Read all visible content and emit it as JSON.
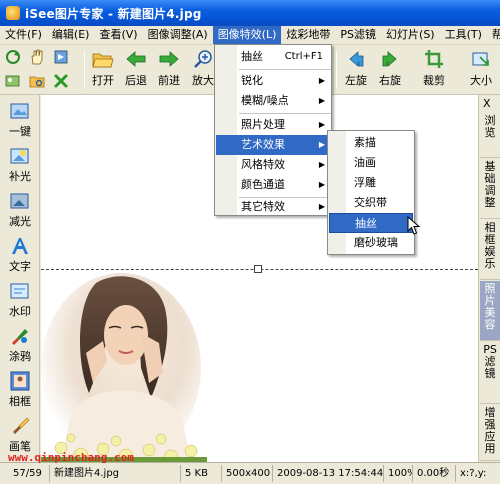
{
  "window": {
    "title": "iSee图片专家 - 新建图片4.jpg"
  },
  "menubar": {
    "items": [
      {
        "label": "文件(F)"
      },
      {
        "label": "编辑(E)"
      },
      {
        "label": "查看(V)"
      },
      {
        "label": "图像调整(A)"
      },
      {
        "label": "图像特效(L)"
      },
      {
        "label": "炫彩地带"
      },
      {
        "label": "PS滤镜"
      },
      {
        "label": "幻灯片(S)"
      },
      {
        "label": "工具(T)"
      },
      {
        "label": "帮"
      }
    ],
    "active_index": 4
  },
  "toolbar": {
    "open": "打开",
    "back": "后退",
    "forward": "前进",
    "zoom_in": "放大",
    "rotate_left": "左旋",
    "rotate_right": "右旋",
    "crop": "裁剪",
    "resize": "大小"
  },
  "leftbar": {
    "items": [
      {
        "label": "一键"
      },
      {
        "label": "补光"
      },
      {
        "label": "减光"
      },
      {
        "label": "文字"
      },
      {
        "label": "水印"
      },
      {
        "label": "涂鸦"
      },
      {
        "label": "相框"
      },
      {
        "label": "画笔"
      }
    ]
  },
  "rightbar": {
    "close": "X",
    "tabs": [
      {
        "label": "浏览"
      },
      {
        "label": "基础调整"
      },
      {
        "label": "相框娱乐"
      },
      {
        "label": "照片美容"
      },
      {
        "label": "PS滤镜"
      },
      {
        "label": "增强应用"
      }
    ]
  },
  "dropdown": {
    "items": [
      {
        "label": "抽丝",
        "shortcut": "Ctrl+F1"
      },
      {
        "label": "锐化",
        "arrow": "▶"
      },
      {
        "label": "模糊/噪点",
        "arrow": "▶"
      },
      {
        "label": "照片处理",
        "arrow": "▶"
      },
      {
        "label": "艺术效果",
        "arrow": "▶"
      },
      {
        "label": "风格特效",
        "arrow": "▶"
      },
      {
        "label": "颜色通道",
        "arrow": "▶"
      },
      {
        "label": "其它特效",
        "arrow": "▶"
      }
    ]
  },
  "submenu": {
    "items": [
      {
        "label": "素描"
      },
      {
        "label": "油画"
      },
      {
        "label": "浮雕"
      },
      {
        "label": "交织带"
      },
      {
        "label": "抽丝"
      },
      {
        "label": "磨砂玻璃"
      }
    ]
  },
  "statusbar": {
    "watermark": "www.qinpinchang.com",
    "index": "57/59",
    "filename": "新建图片4.jpg",
    "size": "5 KB",
    "dimensions": "500x400",
    "datetime": "2009-08-13 17:54:44",
    "zoom": "100%",
    "time": "0.00秒",
    "coords": "x:?,y:"
  },
  "colors": {
    "title_bar": "#0a5ee0",
    "menu_highlight": "#316ac5",
    "watermark": "#e0231c"
  }
}
